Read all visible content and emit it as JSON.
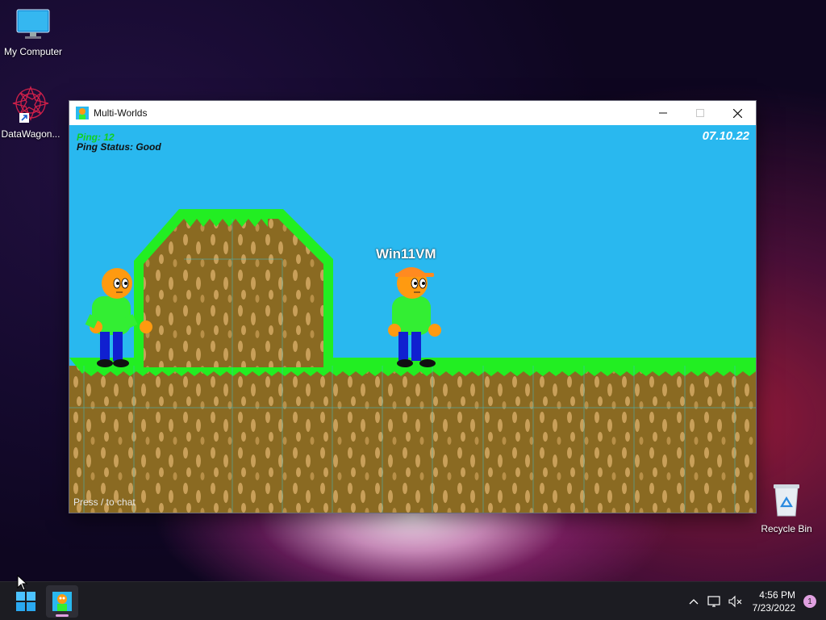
{
  "desktop": {
    "icons": [
      {
        "label": "My Computer"
      },
      {
        "label": "DataWagon..."
      },
      {
        "label": "Recycle Bin"
      }
    ]
  },
  "window": {
    "title": "Multi-Worlds",
    "controls": {
      "minimize": "minimize-icon",
      "maximize": "maximize-icon",
      "close": "close-icon"
    }
  },
  "game": {
    "ping_label": "Ping: 12",
    "ping_status": "Ping Status: Good",
    "date": "07.10.22",
    "player_name": "Win11VM",
    "chat_hint": "Press / to chat",
    "colors": {
      "sky": "#29b8ef",
      "grass": "#22ee22",
      "dirt": "#8a6a22",
      "skin": "#ff9a10",
      "shirt": "#33ee33",
      "pants": "#1020d0",
      "cap": "#ff8a20"
    }
  },
  "taskbar": {
    "time": "4:56 PM",
    "date": "7/23/2022",
    "notification_count": "1"
  }
}
